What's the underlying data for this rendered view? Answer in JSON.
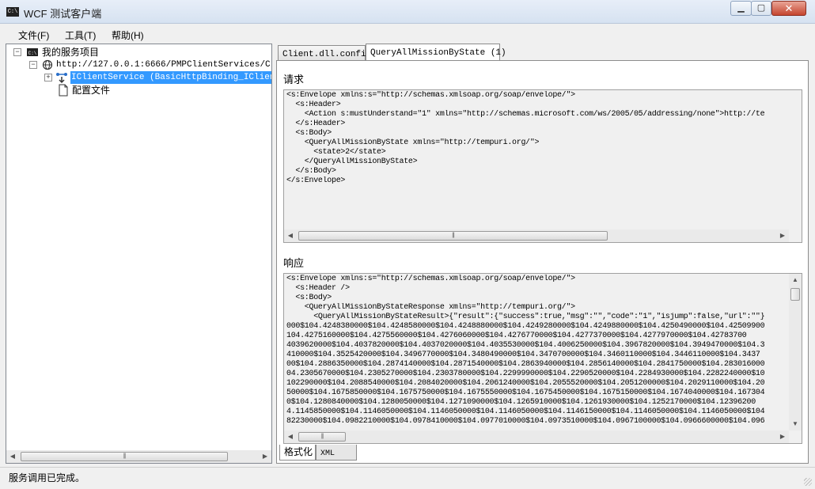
{
  "window": {
    "title": "WCF 测试客户端",
    "icon_text": "C:\\",
    "min_glyph": "▁",
    "max_glyph": "▢",
    "close_glyph": "✕"
  },
  "menu": [
    "文件(F)",
    "工具(T)",
    "帮助(H)"
  ],
  "tree": {
    "root_label": "我的服务项目",
    "endpoint_label": "http://127.0.0.1:6666/PMPClientServices/Clien",
    "service_label": "IClientService (BasicHttpBinding_IClientSe",
    "config_label": "配置文件"
  },
  "tabs": [
    "Client.dll.config",
    "QueryAllMissionByState (1)"
  ],
  "request": {
    "label": "请求",
    "lines": [
      "<s:Envelope xmlns:s=\"http://schemas.xmlsoap.org/soap/envelope/\">",
      "  <s:Header>",
      "    <Action s:mustUnderstand=\"1\" xmlns=\"http://schemas.microsoft.com/ws/2005/05/addressing/none\">http://te",
      "  </s:Header>",
      "  <s:Body>",
      "    <QueryAllMissionByState xmlns=\"http://tempuri.org/\">",
      "      <state>2</state>",
      "    </QueryAllMissionByState>",
      "  </s:Body>",
      "</s:Envelope>"
    ]
  },
  "response": {
    "label": "响应",
    "lines": [
      "<s:Envelope xmlns:s=\"http://schemas.xmlsoap.org/soap/envelope/\">",
      "  <s:Header />",
      "  <s:Body>",
      "    <QueryAllMissionByStateResponse xmlns=\"http://tempuri.org/\">",
      "      <QueryAllMissionByStateResult>{\"result\":{\"success\":true,\"msg\":\"\",\"code\":\"1\",\"isjump\":false,\"url\":\"\"}",
      "000$104.4248380000$104.4248580000$104.4248880000$104.4249280000$104.4249880000$104.4250490000$104.42509900",
      "104.4275160000$104.4275560000$104.4276060000$104.4276770000$104.4277370000$104.4277970000$104.42783700",
      "4039620000$104.4037820000$104.4037020000$104.4035530000$104.4006250000$104.3967820000$104.3949470000$104.3",
      "410000$104.3525420000$104.3496770000$104.3480490000$104.3470700000$104.3460110000$104.3446110000$104.3437",
      "00$104.2886350000$104.2874140000$104.2871540000$104.2863940000$104.2856140000$104.2841750000$104.283016000",
      "04.2305670000$104.2305270000$104.2303780000$104.2299990000$104.2290520000$104.2284930000$104.2282240000$10",
      "102290000$104.2088540000$104.2084020000$104.2061240000$104.2055520000$104.2051200000$104.2029110000$104.20",
      "50000$104.1675850000$104.1675750000$104.1675550000$104.1675450000$104.1675150000$104.1674040000$104.167304",
      "0$104.1280840000$104.1280050000$104.1271090000$104.1265910000$104.1261930000$104.1252170000$104.12396200",
      "4.1145850000$104.1146050000$104.1146050000$104.1146050000$104.1146150000$104.1146050000$104.1146050000$104",
      "82230000$104.0982210000$104.0978410000$104.0977010000$104.0973510000$104.0967100000$104.0966600000$104.096"
    ]
  },
  "bottom_tabs": [
    "格式化",
    "XML"
  ],
  "status": "服务调用已完成。"
}
